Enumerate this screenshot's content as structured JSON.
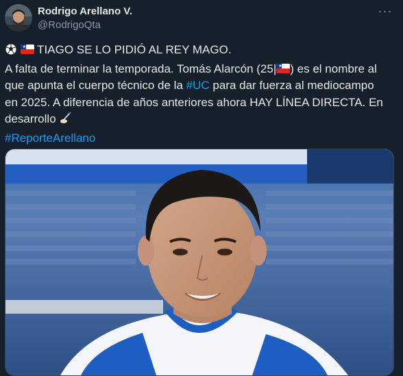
{
  "author": {
    "display_name": "Rodrigo Arellano V.",
    "handle": "@RodrigoQta"
  },
  "more_icon": "ellipsis-icon",
  "tweet": {
    "line1_text": "TIAGO SE LO PIDIÓ AL  REY MAGO.",
    "line2_text": "A falta de terminar la temporada. Tomás Alarcón (25|",
    "line2_end": ") es el nombre al",
    "line3_pre": "que apunta el cuerpo técnico de la ",
    "hashtag_uc": "#UC",
    "line3_post": " para dar fuerza al mediocampo",
    "line4_text": "en 2025. A diferencia de años anteriores ahora HAY LÍNEA DIRECTA. En",
    "line5_text": "desarrollo",
    "hashtag_reporte": "#ReporteArellano"
  },
  "colors": {
    "background": "#15202b",
    "link": "#1d9bf0",
    "text": "#e7e9ea",
    "secondary": "#8b98a5",
    "jersey_blue": "#1d5ab8",
    "chile_red": "#d52b1e"
  },
  "media": {
    "image_subject": "footballer-photo"
  }
}
